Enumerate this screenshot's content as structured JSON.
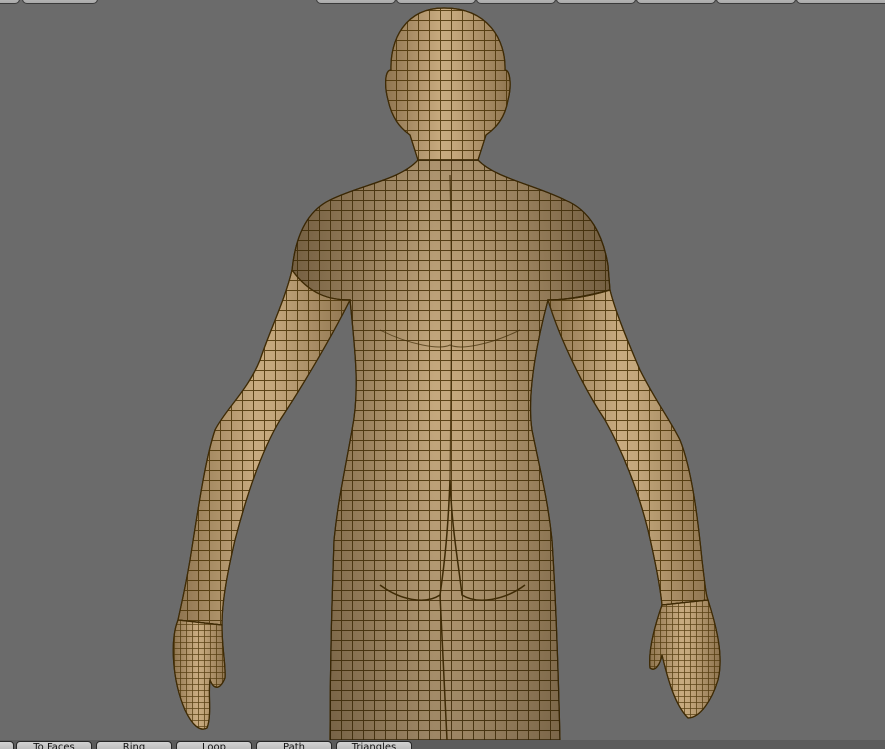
{
  "viewport": {
    "background": "#6b6b6b",
    "model": "human-figure-mesh",
    "view": "back",
    "mesh_color": "#b89c72",
    "wire_color": "#4a3306"
  },
  "bottom_toolbar": {
    "buttons": [
      {
        "label": "",
        "name": "toolbar-button-edge"
      },
      {
        "label": "To Faces",
        "name": "to-faces-button"
      },
      {
        "label": "Ring",
        "name": "ring-button"
      },
      {
        "label": "Loop",
        "name": "loop-button"
      },
      {
        "label": "Path",
        "name": "path-button"
      },
      {
        "label": "Triangles",
        "name": "triangles-button"
      }
    ]
  }
}
